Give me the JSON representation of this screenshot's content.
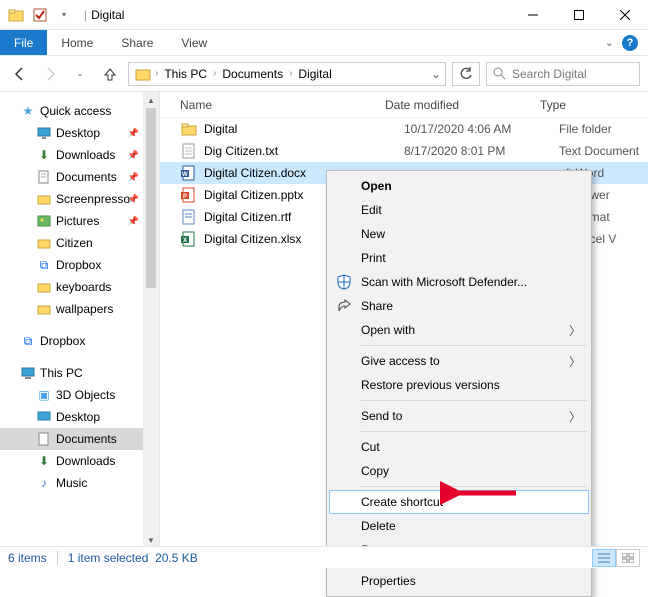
{
  "titlebar": {
    "title": "Digital"
  },
  "ribbon": {
    "file": "File",
    "home": "Home",
    "share": "Share",
    "view": "View"
  },
  "breadcrumb": {
    "thispc": "This PC",
    "documents": "Documents",
    "digital": "Digital"
  },
  "search": {
    "placeholder": "Search Digital"
  },
  "nav": {
    "quick_access": "Quick access",
    "desktop": "Desktop",
    "downloads": "Downloads",
    "documents": "Documents",
    "screenpresso": "Screenpresso",
    "pictures": "Pictures",
    "citizen": "Citizen",
    "dropbox_pin": "Dropbox",
    "keyboards": "keyboards",
    "wallpapers": "wallpapers",
    "dropbox": "Dropbox",
    "thispc": "This PC",
    "objects3d": "3D Objects",
    "desktop2": "Desktop",
    "documents2": "Documents",
    "downloads2": "Downloads",
    "music": "Music"
  },
  "columns": {
    "name": "Name",
    "date": "Date modified",
    "type": "Type"
  },
  "files": [
    {
      "name": "Digital",
      "date": "10/17/2020 4:06 AM",
      "type": "File folder",
      "icon": "folder"
    },
    {
      "name": "Dig Citizen.txt",
      "date": "8/17/2020 8:01 PM",
      "type": "Text Document",
      "icon": "txt"
    },
    {
      "name": "Digital Citizen.docx",
      "date": "",
      "type": "oft Word",
      "icon": "docx",
      "selected": true
    },
    {
      "name": "Digital Citizen.pptx",
      "date": "",
      "type": "oft Power",
      "icon": "pptx"
    },
    {
      "name": "Digital Citizen.rtf",
      "date": "",
      "type": "xt Format",
      "icon": "rtf"
    },
    {
      "name": "Digital Citizen.xlsx",
      "date": "",
      "type": "oft Excel V",
      "icon": "xlsx"
    }
  ],
  "context_menu": {
    "open": "Open",
    "edit": "Edit",
    "new": "New",
    "print": "Print",
    "scan": "Scan with Microsoft Defender...",
    "share": "Share",
    "openwith": "Open with",
    "giveaccess": "Give access to",
    "restore": "Restore previous versions",
    "sendto": "Send to",
    "cut": "Cut",
    "copy": "Copy",
    "shortcut": "Create shortcut",
    "delete": "Delete",
    "rename": "Rename",
    "properties": "Properties"
  },
  "status": {
    "items": "6 items",
    "selected": "1 item selected",
    "size": "20.5 KB"
  }
}
